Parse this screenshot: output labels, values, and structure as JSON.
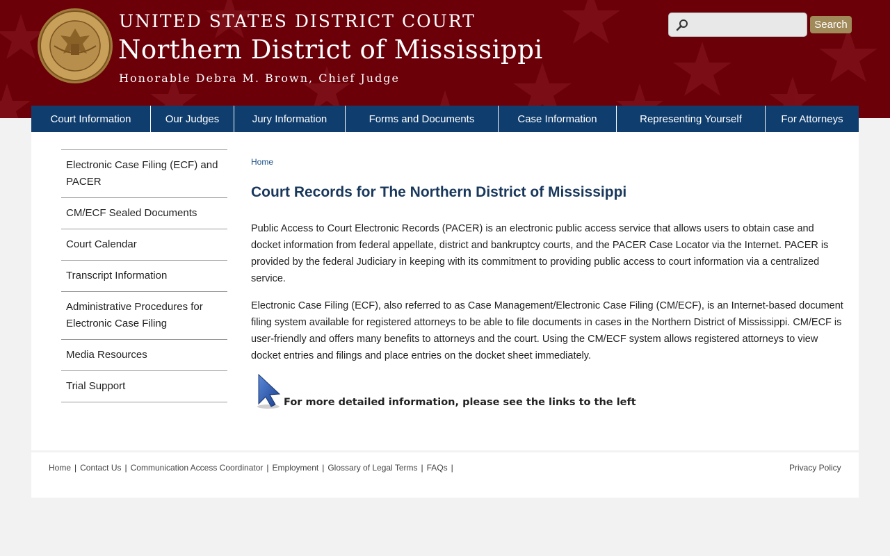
{
  "header": {
    "line1": "UNITED STATES DISTRICT COURT",
    "line2": "Northern District of Mississippi",
    "line3": "Honorable Debra M. Brown, Chief Judge",
    "background_color": "#6b0009"
  },
  "search": {
    "placeholder": "",
    "value": "",
    "button_label": "Search",
    "icon": "search-icon"
  },
  "nav": {
    "items": [
      {
        "label": "Court Information"
      },
      {
        "label": "Our Judges"
      },
      {
        "label": "Jury Information"
      },
      {
        "label": "Forms and Documents"
      },
      {
        "label": "Case Information"
      },
      {
        "label": "Representing Yourself"
      },
      {
        "label": "For Attorneys"
      }
    ],
    "background_color": "#0f3d6e"
  },
  "sidebar": {
    "items": [
      {
        "label": "Electronic Case Filing (ECF) and PACER"
      },
      {
        "label": "CM/ECF Sealed Documents"
      },
      {
        "label": "Court Calendar"
      },
      {
        "label": "Transcript Information"
      },
      {
        "label": "Administrative Procedures for Electronic Case Filing"
      },
      {
        "label": "Media Resources"
      },
      {
        "label": "Trial Support"
      }
    ]
  },
  "main": {
    "breadcrumb": "Home",
    "title": "Court Records for The Northern District of Mississippi",
    "paragraphs": [
      "Public Access to Court Electronic Records (PACER) is an electronic public access service that allows users to obtain case and docket information from federal appellate, district and bankruptcy courts, and the PACER Case Locator via the Internet. PACER is provided by the federal Judiciary in keeping with its commitment to providing public access to court information via a centralized service.",
      "Electronic Case Filing (ECF), also referred to as Case Management/Electronic Case Filing (CM/ECF), is an Internet-based document filing system available for registered attorneys to be able to file documents in cases in the Northern District of Mississippi. CM/ECF is user-friendly and offers many benefits to attorneys and the court. Using the CM/ECF system allows registered attorneys to view docket entries and filings and place entries on the docket sheet immediately."
    ],
    "more_info": "For more detailed information, please see the links to the left",
    "title_color": "#18375b"
  },
  "footer": {
    "links": [
      {
        "label": "Home"
      },
      {
        "label": "Contact Us"
      },
      {
        "label": "Communication Access Coordinator"
      },
      {
        "label": "Employment"
      },
      {
        "label": "Glossary of Legal Terms"
      },
      {
        "label": "FAQs"
      }
    ],
    "separator": "|",
    "privacy": "Privacy Policy"
  }
}
